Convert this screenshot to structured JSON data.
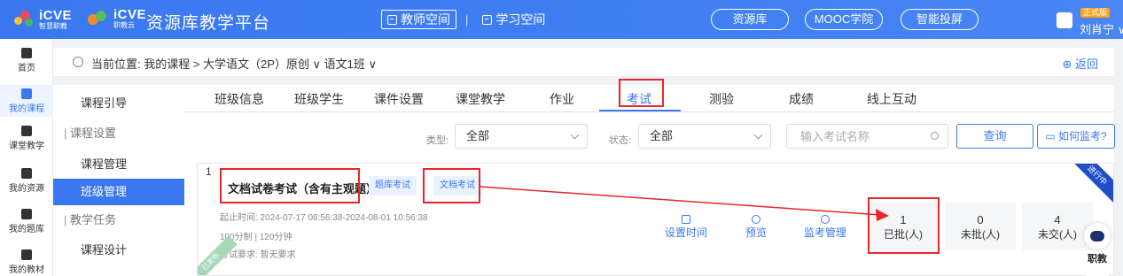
{
  "header": {
    "logo1": "iCVE",
    "logo1_sub": "智慧职教",
    "logo2": "iCVE",
    "logo2_sub": "职教云",
    "platform_title": "资源库教学平台",
    "space_teacher": "教师空间",
    "space_student": "学习空间",
    "pills": [
      "资源库",
      "MOOC学院",
      "智能投屏"
    ],
    "version_badge": "正式版",
    "username": "刘肖宁 ∨"
  },
  "rail": [
    {
      "icon": "home-icon",
      "label": "首页"
    },
    {
      "icon": "course-icon",
      "label": "我的课程"
    },
    {
      "icon": "classroom-icon",
      "label": "课堂教学"
    },
    {
      "icon": "resource-icon",
      "label": "我的资源"
    },
    {
      "icon": "question-bank-icon",
      "label": "我的题库"
    },
    {
      "icon": "textbook-icon",
      "label": "我的教材"
    }
  ],
  "breadcrumb": {
    "text": "当前位置: 我的课程 > 大学语文（2P）原创 ∨  语文1班 ∨",
    "back": "返回"
  },
  "sidebar2": {
    "items": [
      "课程引导",
      "课程设置",
      "课程管理",
      "班级管理",
      "教学任务",
      "课程设计"
    ]
  },
  "tabs": [
    "班级信息",
    "班级学生",
    "课件设置",
    "课堂教学",
    "作业",
    "考试",
    "测验",
    "成绩",
    "线上互动"
  ],
  "filters": {
    "type_label": "类型:",
    "type_value": "全部",
    "status_label": "状态:",
    "status_value": "全部",
    "search_placeholder": "输入考试名称",
    "query_button": "查询",
    "monitor_button": "如何监考?"
  },
  "exam": {
    "index": "1",
    "title": "文档试卷考试（含有主观题）",
    "tag_bank": "题库考试",
    "tag_doc": "文档考试",
    "time": "起止时间: 2024-07-17 08:56:38-2024-08-01 10:56:38",
    "score": "100分制 | 120分钟",
    "requirement": "考试要求: 暂无要求",
    "status_ribbon": "进行中",
    "publish_ribbon": "已发布",
    "actions": [
      "设置时间",
      "预览",
      "监考管理"
    ],
    "stats": [
      {
        "num": "1",
        "label": "已批(人)"
      },
      {
        "num": "0",
        "label": "未批(人)"
      },
      {
        "num": "4",
        "label": "未交(人)"
      }
    ]
  },
  "float_side": "职教",
  "colors": {
    "primary": "#3b78f0",
    "highlight": "#e8262a"
  }
}
